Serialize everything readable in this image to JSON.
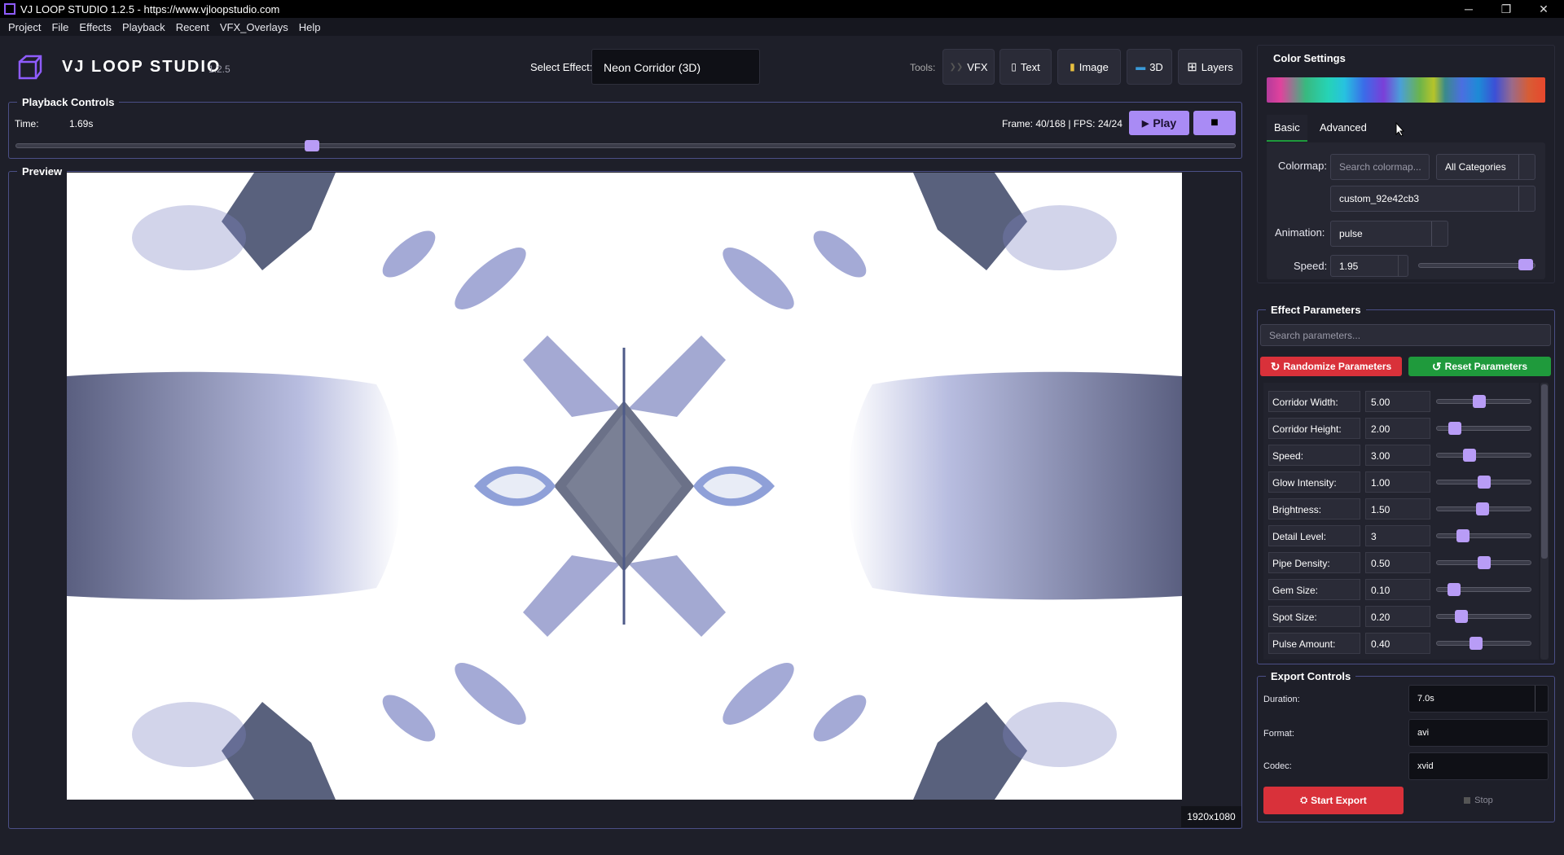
{
  "window": {
    "title": "VJ LOOP STUDIO 1.2.5 - https://www.vjloopstudio.com",
    "minimize_symbol": "─",
    "restore_symbol": "❐",
    "close_symbol": "✕"
  },
  "menu": [
    "Project",
    "File",
    "Effects",
    "Playback",
    "Recent",
    "VFX_Overlays",
    "Help"
  ],
  "header": {
    "brand": "VJ LOOP STUDIO",
    "version": "1.2.5",
    "select_effect_label": "Select Effect:",
    "selected_effect": "Neon Corridor (3D)",
    "tools_label": "Tools:",
    "tools": [
      {
        "label": "VFX",
        "icon": "vfx-icon",
        "glyph": "❯❯"
      },
      {
        "label": "Text",
        "icon": "text-doc-icon",
        "glyph": "▯"
      },
      {
        "label": "Image",
        "icon": "image-icon",
        "glyph": "▮"
      },
      {
        "label": "3D",
        "icon": "monitor-icon",
        "glyph": "▬"
      },
      {
        "label": "Layers",
        "icon": "grid-icon",
        "glyph": "⊞"
      }
    ]
  },
  "playback": {
    "title": "Playback Controls",
    "time_label": "Time:",
    "time_value": "1.69s",
    "frame_info": "Frame: 40/168 | FPS: 24/24",
    "play_label": "Play",
    "play_glyph": "▶",
    "stop_glyph": "■",
    "progress": 0.24
  },
  "preview": {
    "title": "Preview",
    "resolution": "1920x1080"
  },
  "color_settings": {
    "title": "Color Settings",
    "tabs": [
      "Basic",
      "Advanced"
    ],
    "active_tab": "Basic",
    "colormap_label": "Colormap:",
    "colormap_search_placeholder": "Search colormap...",
    "category": "All Categories",
    "colormap_value": "custom_92e42cb3",
    "animation_label": "Animation:",
    "animation_value": "pulse",
    "speed_label": "Speed:",
    "speed_value": "1.95",
    "speed_fraction": 0.98
  },
  "effect_parameters": {
    "title": "Effect Parameters",
    "search_placeholder": "Search parameters...",
    "randomize_label": "Randomize Parameters",
    "reset_label": "Reset Parameters",
    "randomize_glyph": "↻",
    "reset_glyph": "↺",
    "params": [
      {
        "label": "Corridor Width:",
        "value": "5.00",
        "fraction": 0.45
      },
      {
        "label": "Corridor Height:",
        "value": "2.00",
        "fraction": 0.15
      },
      {
        "label": "Speed:",
        "value": "3.00",
        "fraction": 0.33
      },
      {
        "label": "Glow Intensity:",
        "value": "1.00",
        "fraction": 0.5
      },
      {
        "label": "Brightness:",
        "value": "1.50",
        "fraction": 0.49
      },
      {
        "label": "Detail Level:",
        "value": "3",
        "fraction": 0.25
      },
      {
        "label": "Pipe Density:",
        "value": "0.50",
        "fraction": 0.5
      },
      {
        "label": "Gem Size:",
        "value": "0.10",
        "fraction": 0.14
      },
      {
        "label": "Spot Size:",
        "value": "0.20",
        "fraction": 0.23
      },
      {
        "label": "Pulse Amount:",
        "value": "0.40",
        "fraction": 0.41
      }
    ]
  },
  "export": {
    "title": "Export Controls",
    "duration_label": "Duration:",
    "duration_value": "7.0s",
    "format_label": "Format:",
    "format_value": "avi",
    "codec_label": "Codec:",
    "codec_value": "xvid",
    "start_label": "Start Export",
    "stop_label": "Stop"
  }
}
